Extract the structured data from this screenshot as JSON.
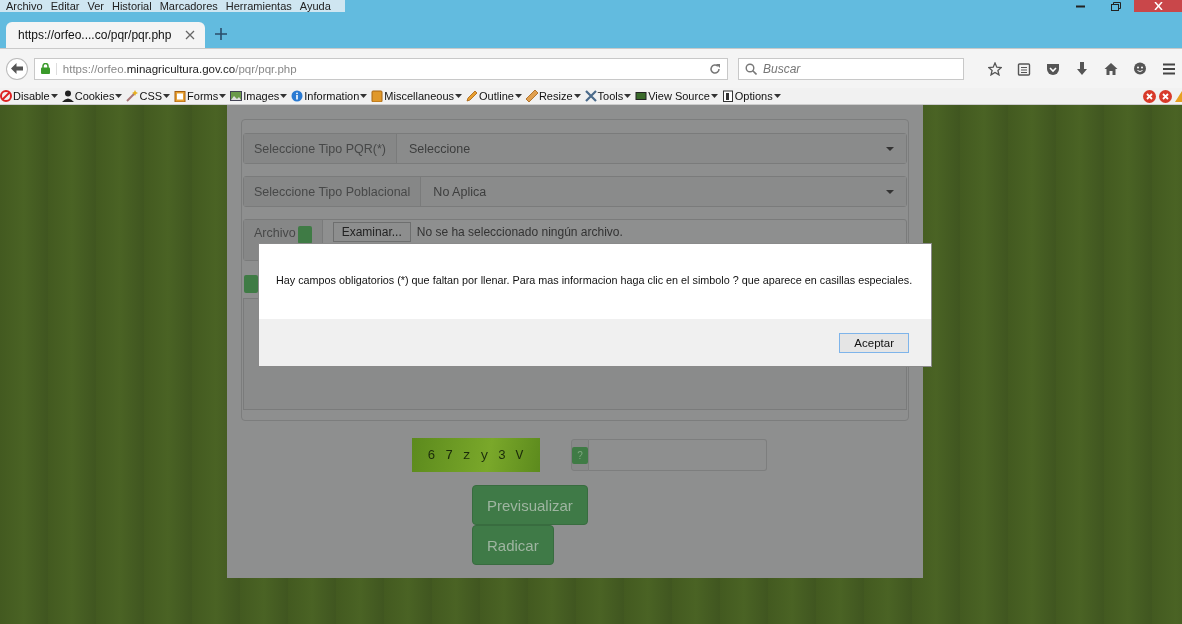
{
  "menu_bar": [
    "Archivo",
    "Editar",
    "Ver",
    "Historial",
    "Marcadores",
    "Herramientas",
    "Ayuda"
  ],
  "tabs": [
    {
      "label": "https://orfeo....co/pqr/pqr.php",
      "selected": true
    }
  ],
  "address_bar": {
    "url": "https://orfeo.**minagricultura.gov.co**/pqr/pqr.php"
  },
  "search": {
    "placeholder": "Buscar"
  },
  "addon_toolbar": [
    {
      "kind": "disable",
      "label": "Disable"
    },
    {
      "kind": "cookies",
      "label": "Cookies"
    },
    {
      "kind": "css",
      "label": "CSS"
    },
    {
      "kind": "forms",
      "label": "Forms"
    },
    {
      "kind": "images",
      "label": "Images"
    },
    {
      "kind": "information",
      "label": "Information"
    },
    {
      "kind": "miscellaneous",
      "label": "Miscellaneous"
    },
    {
      "kind": "outline",
      "label": "Outline"
    },
    {
      "kind": "resize",
      "label": "Resize"
    },
    {
      "kind": "tools",
      "label": "Tools"
    },
    {
      "kind": "source",
      "label": "View Source"
    },
    {
      "kind": "options",
      "label": "Options"
    }
  ],
  "form": {
    "selects": [
      {
        "label": "Seleccione Tipo PQR(*)",
        "value": "Seleccione"
      },
      {
        "label": "Seleccione Tipo Poblacional",
        "value": "No Aplica"
      }
    ],
    "file": {
      "label": "Archivo",
      "button": "Examinar...",
      "status": "No se ha seleccionado ningún archivo."
    },
    "captcha": {
      "code": "6 7 z y 3 V",
      "help": "?"
    },
    "buttons": [
      "Previsualizar",
      "Radicar"
    ]
  },
  "dialog": {
    "message": "Hay campos obligatorios (*) que faltan por llenar. Para mas informacion haga clic en el simbolo ? que aparece en casillas especiales.",
    "button": "Aceptar"
  }
}
